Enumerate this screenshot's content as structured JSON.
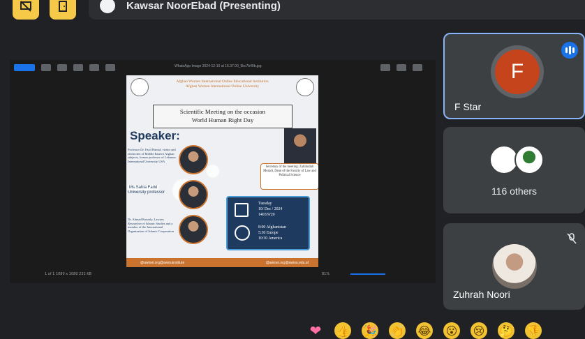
{
  "topbar": {
    "left_icons": [
      "presentation-off-icon",
      "exit-door-icon"
    ],
    "presenter_label": "Kawsar NoorEbad (Presenting)"
  },
  "viewer": {
    "file_title": "WhatsApp Image 2024-12-10 at 16.37.00_6bc7b49b.jpg",
    "zoom": "81%",
    "bottom_left": "1 of 1 1080 x 1080 231 KB"
  },
  "poster": {
    "institution_line1": "Afghan Women International Online Educational Institution",
    "institution_line2": "Afghan Women International Online University",
    "title_line1": "Scientific Meeting on the occasion",
    "title_line2": "World Human Right Day",
    "speaker_heading": "Speaker:",
    "speaker1": "Professor Dr. Fazil Hamid, visitor and researcher of Middle Eastern Afghan subjects, former professor of Lebanon International University USA",
    "speaker2_name": "Ms.Sahla Farid",
    "speaker2_role": "University professor",
    "speaker3": "Dr. Ahmad Rasouly, Lawyer, Researcher of Islamic Studies and a member of the International Organization of Islamic Cooperation",
    "secretary": "Secretary of the meeting: Zabihullah Moradi, Dean of the Faculty of Law and Political Science",
    "date_day": "Tuesday",
    "date_gregorian": "10/ Dec / 2024",
    "date_solar": "1403/9/20",
    "time1": "8:00 Afghanistan",
    "time2": "5:30 Europe",
    "time3": "10:30 America",
    "footer_left": "@awioei.org@awiouinstitute",
    "footer_right": "@awioei.org@awiou.edu.af"
  },
  "participants": [
    {
      "name": "F Star",
      "initial": "F",
      "avatar_color": "#c5441b",
      "speaking": true
    },
    {
      "name": "116 others"
    },
    {
      "name": "Zuhrah Noori",
      "muted": true
    }
  ],
  "reactions": [
    "heart-icon",
    "thumbs-up-icon",
    "party-popper-icon",
    "clapping-icon",
    "laughing-icon",
    "surprised-icon",
    "crying-icon",
    "thinking-icon",
    "thumbs-down-icon"
  ],
  "reaction_glyphs": [
    "❤",
    "👍",
    "🎉",
    "👏",
    "😂",
    "😮",
    "😢",
    "🤔",
    "👎"
  ]
}
